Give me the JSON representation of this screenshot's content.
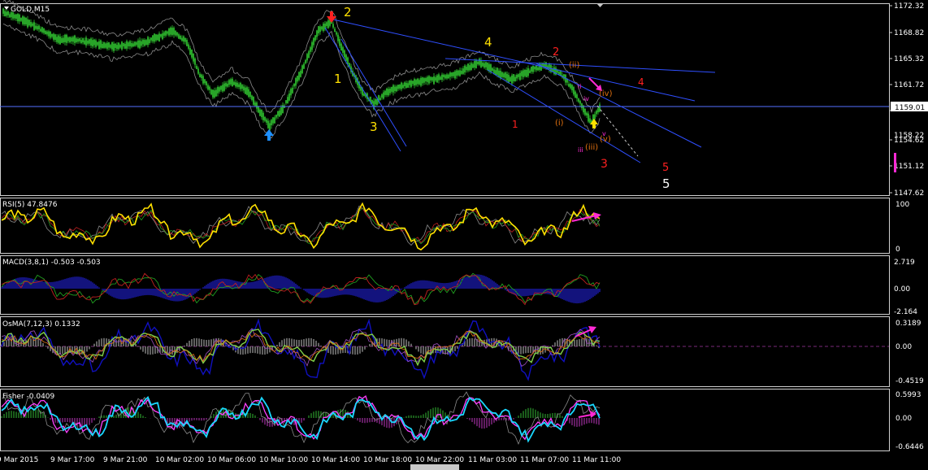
{
  "app": {
    "symbol_label": "GOLD,M15",
    "current_price": "1159.01"
  },
  "colors": {
    "background": "#000000",
    "frame": "#d0d0d0",
    "candle": "#33cc33",
    "bands": "#8a8a8a",
    "trendline": "#2f4fff",
    "price_line": "#5570ff",
    "yellow": "#ffe000",
    "red": "#ff2020",
    "orange": "#e07010",
    "magenta": "#ff2ad4",
    "blue_arrow": "#1e90ff",
    "histogram_blue": "#2020d0",
    "cyan": "#19d7ff",
    "green_bars": "#2b9b2b"
  },
  "main_panel": {
    "price_axis": [
      "1172.32",
      "1168.82",
      "1165.32",
      "1161.72",
      "1158.22",
      "1154.62",
      "1151.12",
      "1147.62"
    ],
    "price_range": [
      1145.9,
      1173.7
    ],
    "horizontal_line_price": 1159.01,
    "wave_labels": [
      {
        "text": "2",
        "color": "yellow"
      },
      {
        "text": "1",
        "color": "yellow"
      },
      {
        "text": "3",
        "color": "yellow"
      },
      {
        "text": "4",
        "color": "yellow"
      },
      {
        "text": "5",
        "color": "white"
      },
      {
        "text": "2",
        "color": "red"
      },
      {
        "text": "1",
        "color": "red"
      },
      {
        "text": "3",
        "color": "red"
      },
      {
        "text": "4",
        "color": "red"
      },
      {
        "text": "5",
        "color": "red"
      },
      {
        "text": "(ii)",
        "color": "orange"
      },
      {
        "text": "(i)",
        "color": "orange"
      },
      {
        "text": "(iv)",
        "color": "orange"
      },
      {
        "text": "(iii)",
        "color": "orange"
      },
      {
        "text": "(v)",
        "color": "orange"
      },
      {
        "text": "ii",
        "color": "magenta"
      },
      {
        "text": "iv",
        "color": "magenta"
      },
      {
        "text": "iii",
        "color": "magenta"
      },
      {
        "text": "v",
        "color": "magenta"
      }
    ]
  },
  "indicators": {
    "rsi": {
      "label": "RSI(5) 47.8476",
      "axis": [
        "100",
        "0"
      ]
    },
    "macd": {
      "label": "MACD(3,8,1) -0.503 -0.503",
      "axis": [
        "2.719",
        "0.00",
        "-2.164"
      ]
    },
    "osma": {
      "label": "OsMA(7,12,3) 0.1332",
      "axis": [
        "0.3189",
        "0.00",
        "-0.4519"
      ]
    },
    "fisher": {
      "label": "Fisher -0.0409",
      "axis": [
        "0.5993",
        "0.00",
        "-0.6446"
      ]
    }
  },
  "time_axis": [
    "9 Mar 2015",
    "9 Mar 17:00",
    "9 Mar 21:00",
    "10 Mar 02:00",
    "10 Mar 06:00",
    "10 Mar 10:00",
    "10 Mar 14:00",
    "10 Mar 18:00",
    "10 Mar 22:00",
    "11 Mar 03:00",
    "11 Mar 07:00",
    "11 Mar 11:00"
  ]
}
